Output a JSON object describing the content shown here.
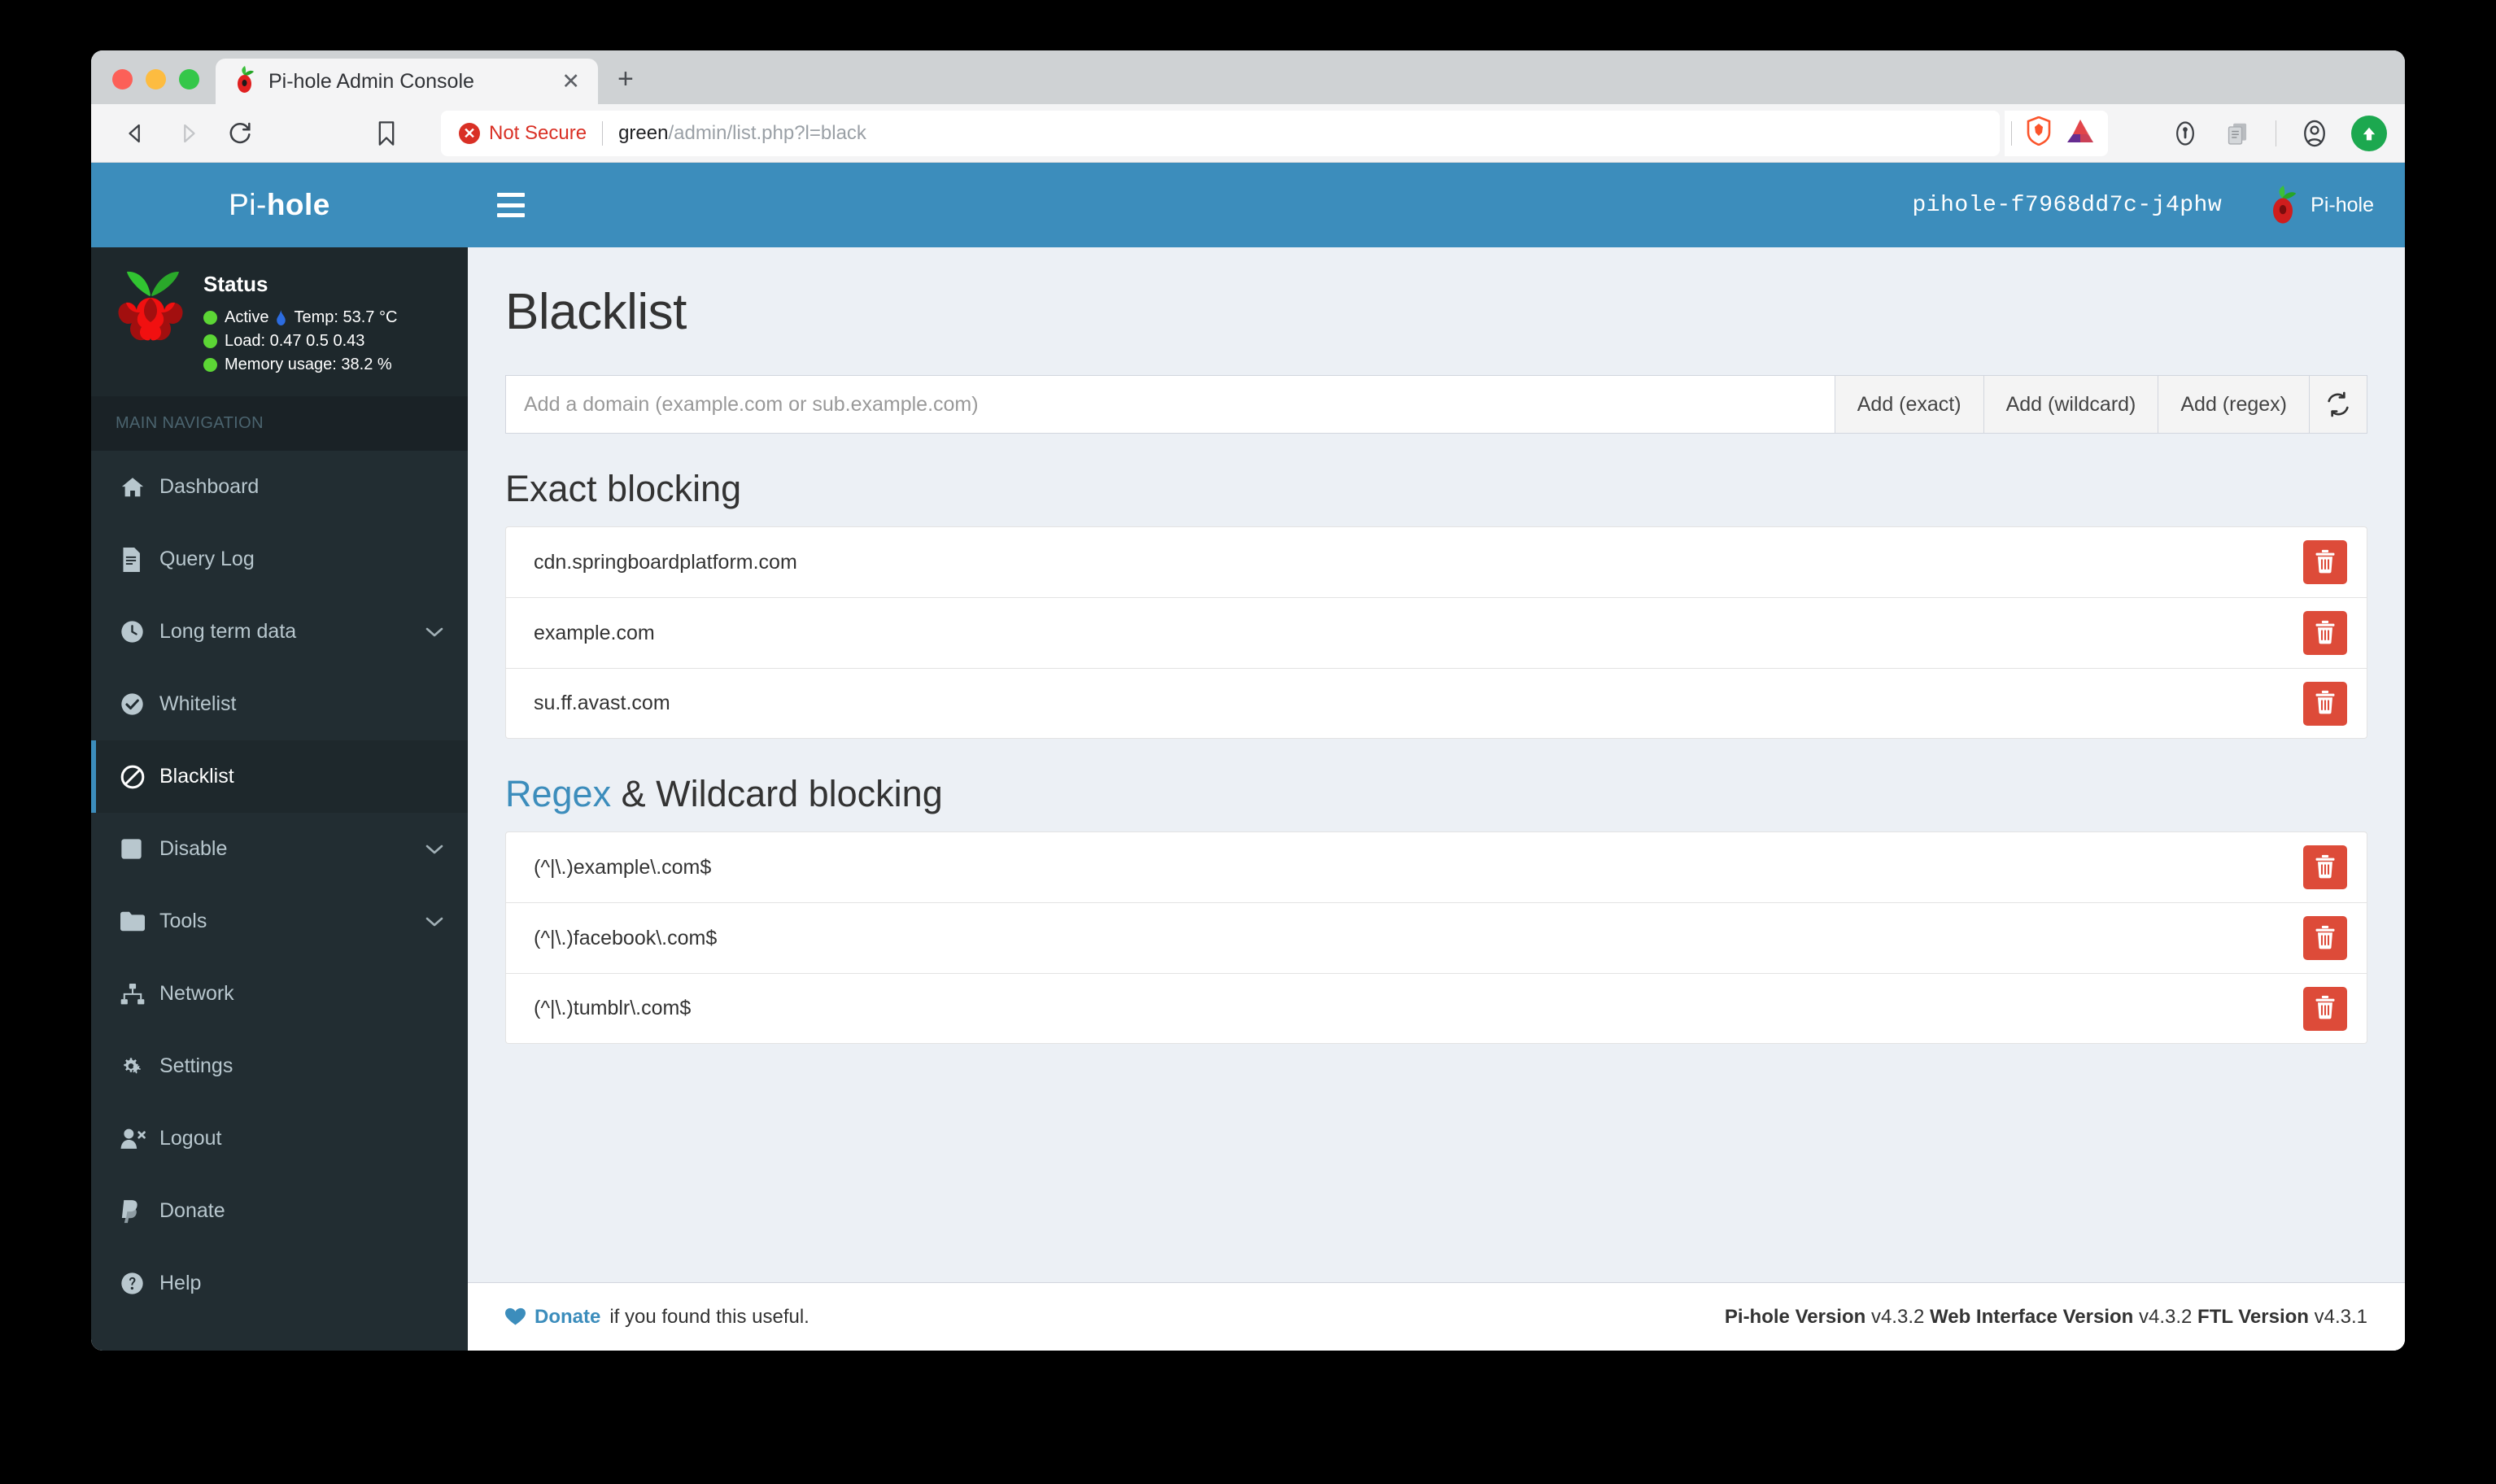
{
  "browser": {
    "tab_title": "Pi-hole Admin Console",
    "tab_close_label": "✕",
    "new_tab_label": "+",
    "security_label": "Not Secure",
    "security_icon_glyph": "✕",
    "url_host": "green",
    "url_path": "/admin/list.php?l=black",
    "icons": {
      "back": "back-arrow-icon",
      "forward": "forward-arrow-icon",
      "reload": "reload-icon",
      "bookmark": "bookmark-icon",
      "brave_shield": "brave-lion-shield-icon",
      "bat_rewards": "brave-bat-triangle-icon",
      "password_manager": "key-icon",
      "clipboard": "clipboard-icon",
      "profile": "profile-avatar-icon",
      "update": "update-upload-icon"
    },
    "accent_red": "#d93025",
    "update_green": "#1ca84f"
  },
  "sidebar": {
    "brand": {
      "light": "Pi-",
      "bold": "hole"
    },
    "status": {
      "title": "Status",
      "lines": [
        {
          "text": "Active",
          "extra": "Temp: 53.7 °C",
          "has_flame": true
        },
        {
          "text": "Load:  0.47  0.5  0.43",
          "extra": "",
          "has_flame": false
        },
        {
          "text": "Memory usage:  38.2 %",
          "extra": "",
          "has_flame": false
        }
      ]
    },
    "nav_header": "MAIN NAVIGATION",
    "items": [
      {
        "label": "Dashboard",
        "icon": "home-icon",
        "chevron": false,
        "active": false
      },
      {
        "label": "Query Log",
        "icon": "file-icon",
        "chevron": false,
        "active": false
      },
      {
        "label": "Long term data",
        "icon": "clock-icon",
        "chevron": true,
        "active": false
      },
      {
        "label": "Whitelist",
        "icon": "check-circle-icon",
        "chevron": false,
        "active": false
      },
      {
        "label": "Blacklist",
        "icon": "ban-icon",
        "chevron": false,
        "active": true
      },
      {
        "label": "Disable",
        "icon": "square-icon",
        "chevron": true,
        "active": false
      },
      {
        "label": "Tools",
        "icon": "folder-icon",
        "chevron": true,
        "active": false
      },
      {
        "label": "Network",
        "icon": "sitemap-icon",
        "chevron": false,
        "active": false
      },
      {
        "label": "Settings",
        "icon": "gears-icon",
        "chevron": false,
        "active": false
      },
      {
        "label": "Logout",
        "icon": "user-times-icon",
        "chevron": false,
        "active": false
      },
      {
        "label": "Donate",
        "icon": "paypal-icon",
        "chevron": false,
        "active": false
      },
      {
        "label": "Help",
        "icon": "question-circle-icon",
        "chevron": false,
        "active": false
      }
    ],
    "bg_color": "#222d32",
    "brand_color": "#3c8dbc"
  },
  "header": {
    "hostname": "pihole-f7968dd7c-j4phw",
    "brand_text": "Pi-hole"
  },
  "main": {
    "page_title": "Blacklist",
    "form": {
      "placeholder": "Add a domain (example.com or sub.example.com)",
      "value": "",
      "buttons": [
        "Add (exact)",
        "Add (wildcard)",
        "Add (regex)"
      ],
      "refresh_icon": "refresh-sync-icon"
    },
    "exact_section": {
      "title": "Exact blocking",
      "domains": [
        "cdn.springboardplatform.com",
        "example.com",
        "su.ff.avast.com"
      ]
    },
    "regex_section": {
      "title_link": "Regex",
      "title_rest": " & Wildcard blocking",
      "domains": [
        "(^|\\.)example\\.com$",
        "(^|\\.)facebook\\.com$",
        "(^|\\.)tumblr\\.com$"
      ]
    },
    "delete_icon": "trash-icon",
    "delete_color": "#dd4b39"
  },
  "footer": {
    "donate_link": "Donate",
    "donate_rest": " if you found this useful.",
    "versions": [
      {
        "name": "Pi-hole Version",
        "value": " v4.3.2 "
      },
      {
        "name": "Web Interface Version",
        "value": " v4.3.2 "
      },
      {
        "name": "FTL Version",
        "value": " v4.3.1"
      }
    ]
  }
}
